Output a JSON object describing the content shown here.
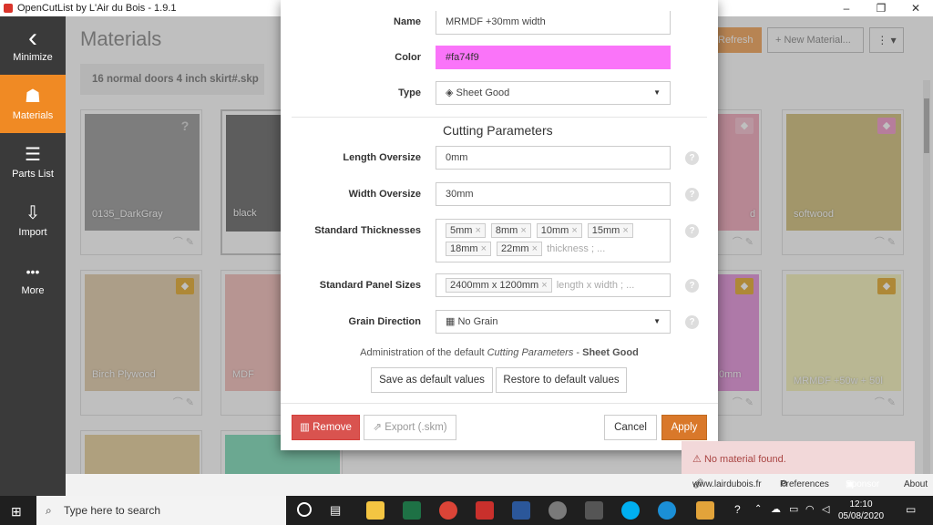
{
  "window": {
    "title": "OpenCutList by L'Air du Bois - 1.9.1",
    "minimize": "–",
    "restore": "❐",
    "close": "✕"
  },
  "sidebar": {
    "items": [
      {
        "label": "Minimize",
        "icon": "‹"
      },
      {
        "label": "Materials",
        "icon": "☗"
      },
      {
        "label": "Parts List",
        "icon": "☰"
      },
      {
        "label": "Import",
        "icon": "⇩"
      },
      {
        "label": "More",
        "icon": "•••"
      }
    ]
  },
  "page": {
    "title": "Materials",
    "file_tab": "16 normal doors 4 inch skirt#.skp",
    "refresh": "Refresh",
    "new_material": "New Material...",
    "more": "⋮ ▾"
  },
  "cards": [
    {
      "name": "0135_DarkGray",
      "color": "#a7a7a7",
      "badge": "?"
    },
    {
      "name": "black",
      "color": "#7d7d7d",
      "badge": ""
    },
    {
      "name": "d",
      "color": "#f3b4c4",
      "badge": "◆"
    },
    {
      "name": "softwood",
      "color": "#d8c98e",
      "badge": "◆"
    },
    {
      "name": "Birch Plywood",
      "color": "#e6d3b6",
      "badge": "◆"
    },
    {
      "name": "MDF",
      "color": "#f4c7c3",
      "badge": ""
    },
    {
      "name": "0mm",
      "color": "#e9a2e1",
      "badge": "◆"
    },
    {
      "name": "MRMDF +50w + 50l",
      "color": "#f7f5c4",
      "badge": "◆"
    }
  ],
  "dialog": {
    "name_label": "Name",
    "name_value": "MRMDF +30mm width",
    "color_label": "Color",
    "color_value": "#fa74f9",
    "type_label": "Type",
    "type_value": "Sheet Good",
    "section_title": "Cutting Parameters",
    "length_label": "Length Oversize",
    "length_value": "0mm",
    "width_label": "Width Oversize",
    "width_value": "30mm",
    "thick_label": "Standard Thicknesses",
    "thicknesses": [
      "5mm",
      "8mm",
      "10mm",
      "15mm",
      "18mm",
      "22mm"
    ],
    "thick_placeholder": "thickness ; ...",
    "panel_label": "Standard Panel Sizes",
    "panels": [
      "2400mm x 1200mm"
    ],
    "panel_placeholder": "length x width ; ...",
    "grain_label": "Grain Direction",
    "grain_value": "No Grain",
    "admin_prefix": "Administration of the default ",
    "admin_italic": "Cutting Parameters",
    "admin_dash": " - ",
    "admin_bold": "Sheet Good",
    "save_defaults": "Save as default values",
    "restore_defaults": "Restore to default values",
    "remove": "Remove",
    "export": "Export (.skm)",
    "cancel": "Cancel",
    "apply": "Apply",
    "help": "?"
  },
  "toast": {
    "text": "No material found."
  },
  "footer": {
    "site": "www.lairdubois.fr",
    "preferences": "Preferences",
    "sponsor": "Sponsor",
    "about": "About"
  },
  "taskbar": {
    "search": "Type here to search",
    "time": "12:10",
    "date": "05/08/2020"
  },
  "colors": {
    "accent": "#f08a24",
    "remove": "#d9534f",
    "apply": "#d9782a",
    "swatch": "#fa74f9",
    "sponsor": "#e8508f"
  }
}
